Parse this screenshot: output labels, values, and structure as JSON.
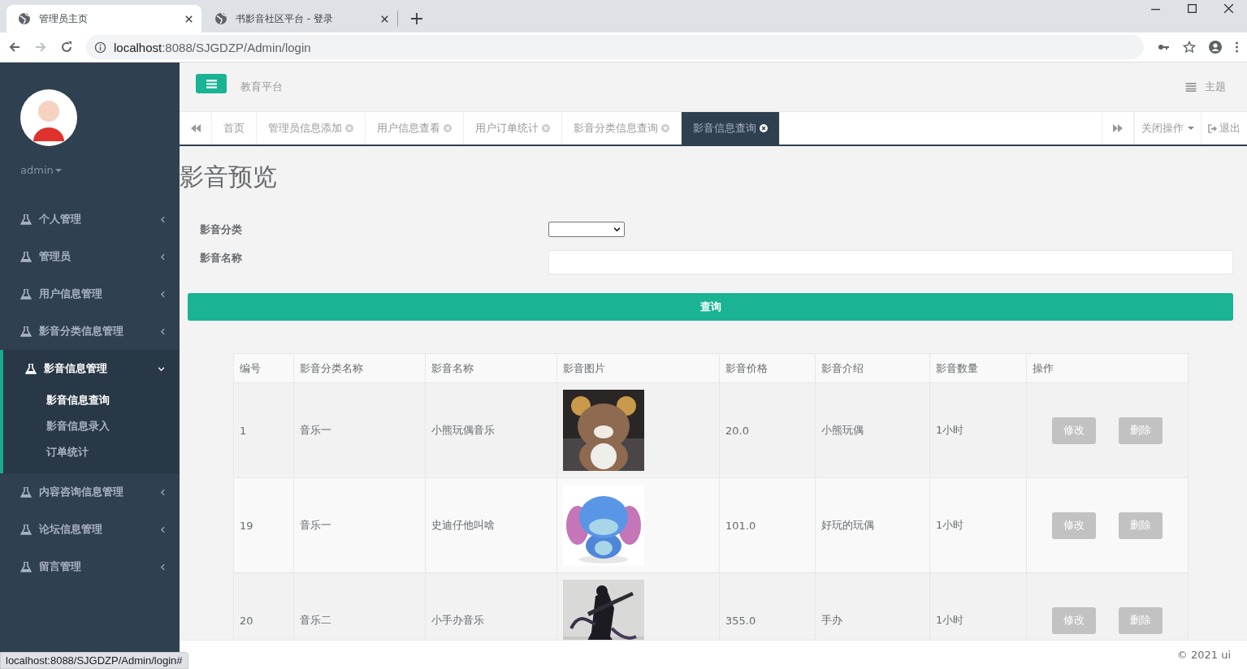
{
  "browser": {
    "tabs": [
      {
        "title": "管理员主页",
        "selected": true
      },
      {
        "title": "书影音社区平台 - 登录",
        "selected": false
      }
    ],
    "url": {
      "host": "localhost",
      "rest": ":8088/SJGDZP/Admin/login"
    }
  },
  "sidebar": {
    "user": "admin",
    "menu": [
      {
        "label": "个人管理",
        "expanded": false
      },
      {
        "label": "管理员",
        "expanded": false
      },
      {
        "label": "用户信息管理",
        "expanded": false
      },
      {
        "label": "影音分类信息管理",
        "expanded": false
      },
      {
        "label": "影音信息管理",
        "expanded": true,
        "children": [
          {
            "label": "影音信息查询",
            "selected": true
          },
          {
            "label": "影音信息录入",
            "selected": false
          },
          {
            "label": "订单统计",
            "selected": false
          }
        ]
      },
      {
        "label": "内容咨询信息管理",
        "expanded": false
      },
      {
        "label": "论坛信息管理",
        "expanded": false
      },
      {
        "label": "留言管理",
        "expanded": false
      }
    ]
  },
  "topbar": {
    "brand": "教育平台",
    "theme": "主题"
  },
  "page_tabs": [
    {
      "label": "首页",
      "closable": false,
      "selected": false
    },
    {
      "label": "管理员信息添加",
      "closable": true,
      "selected": false
    },
    {
      "label": "用户信息查看",
      "closable": true,
      "selected": false
    },
    {
      "label": "用户订单统计",
      "closable": true,
      "selected": false
    },
    {
      "label": "影音分类信息查询",
      "closable": true,
      "selected": false
    },
    {
      "label": "影音信息查询",
      "closable": true,
      "selected": true
    }
  ],
  "tab_actions": {
    "close_menu": "关闭操作",
    "logout": "退出"
  },
  "heading": "影音预览",
  "form": {
    "fields": [
      {
        "label": "影音分类",
        "kind": "select"
      },
      {
        "label": "影音名称",
        "kind": "text"
      }
    ],
    "submit": "查询"
  },
  "table": {
    "columns": [
      "编号",
      "影音分类名称",
      "影音名称",
      "影音图片",
      "影音价格",
      "影音介绍",
      "影音数量",
      "操作"
    ],
    "rows": [
      {
        "id": "1",
        "category": "音乐一",
        "name": "小熊玩偶音乐",
        "picture": {
          "kind": "picture"
        },
        "price": "20.0",
        "intro": "小熊玩偶",
        "quantity": "1小时",
        "actions": [
          "修改",
          "删除"
        ]
      },
      {
        "id": "19",
        "category": "音乐一",
        "name": "史迪仔他叫啥",
        "picture": {
          "kind": "picture"
        },
        "price": "101.0",
        "intro": "好玩的玩偶",
        "quantity": "1小时",
        "actions": [
          "修改",
          "删除"
        ]
      },
      {
        "id": "20",
        "category": "音乐二",
        "name": "小手办音乐",
        "picture": {
          "kind": "picture"
        },
        "price": "355.0",
        "intro": "手办",
        "quantity": "1小时",
        "actions": [
          "修改",
          "删除"
        ]
      }
    ]
  },
  "footer": "© 2021 ui",
  "status_bar": "localhost:8088/SJGDZP/Admin/login#"
}
